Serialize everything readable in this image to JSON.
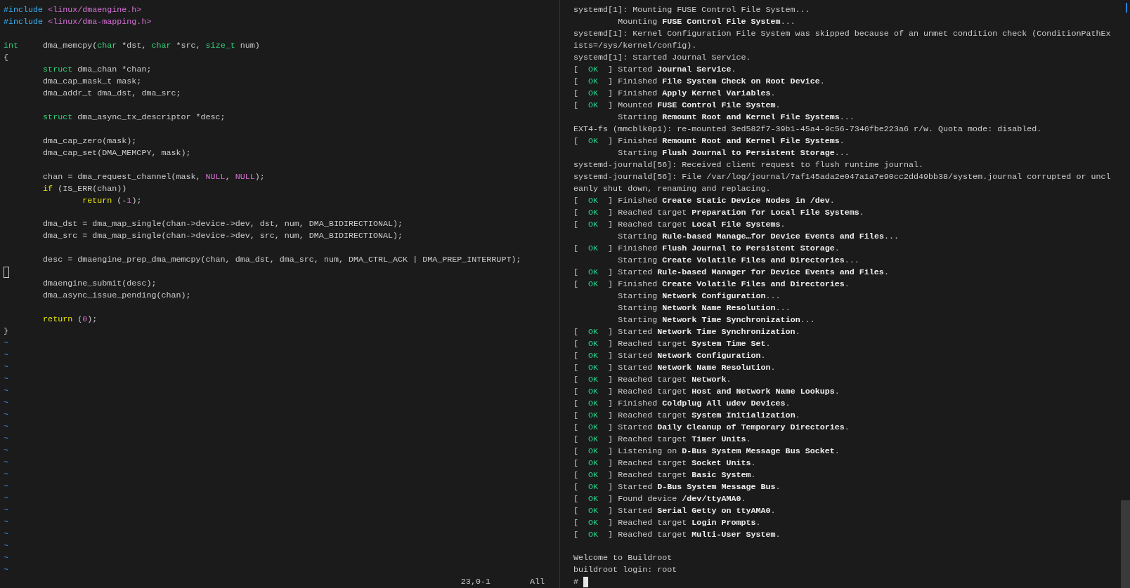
{
  "editor": {
    "lines": [
      {
        "kind": "code",
        "segments": [
          {
            "kind": "preproc",
            "text": "#include "
          },
          {
            "kind": "string",
            "text": "<linux/dmaengine.h>"
          }
        ]
      },
      {
        "kind": "code",
        "segments": [
          {
            "kind": "preproc",
            "text": "#include "
          },
          {
            "kind": "string",
            "text": "<linux/dma-mapping.h>"
          }
        ]
      },
      {
        "kind": "blank"
      },
      {
        "kind": "code",
        "segments": [
          {
            "kind": "type",
            "text": "int"
          },
          {
            "kind": "plain",
            "text": "\tdma_memcpy("
          },
          {
            "kind": "type",
            "text": "char"
          },
          {
            "kind": "plain",
            "text": " *dst, "
          },
          {
            "kind": "type",
            "text": "char"
          },
          {
            "kind": "plain",
            "text": " *src, "
          },
          {
            "kind": "type",
            "text": "size_t"
          },
          {
            "kind": "plain",
            "text": " num)"
          }
        ]
      },
      {
        "kind": "code",
        "segments": [
          {
            "kind": "plain",
            "text": "{"
          }
        ]
      },
      {
        "kind": "code",
        "segments": [
          {
            "kind": "type",
            "text": "\tstruct"
          },
          {
            "kind": "plain",
            "text": " dma_chan *chan;"
          }
        ]
      },
      {
        "kind": "code",
        "segments": [
          {
            "kind": "plain",
            "text": "\tdma_cap_mask_t mask;"
          }
        ]
      },
      {
        "kind": "code",
        "segments": [
          {
            "kind": "plain",
            "text": "\tdma_addr_t dma_dst, dma_src;"
          }
        ]
      },
      {
        "kind": "blank"
      },
      {
        "kind": "code",
        "segments": [
          {
            "kind": "type",
            "text": "\tstruct"
          },
          {
            "kind": "plain",
            "text": " dma_async_tx_descriptor *desc;"
          }
        ]
      },
      {
        "kind": "blank"
      },
      {
        "kind": "code",
        "segments": [
          {
            "kind": "plain",
            "text": "\tdma_cap_zero(mask);"
          }
        ]
      },
      {
        "kind": "code",
        "segments": [
          {
            "kind": "plain",
            "text": "\tdma_cap_set(DMA_MEMCPY, mask);"
          }
        ]
      },
      {
        "kind": "blank"
      },
      {
        "kind": "code",
        "segments": [
          {
            "kind": "plain",
            "text": "\tchan = dma_request_channel(mask, "
          },
          {
            "kind": "constant",
            "text": "NULL"
          },
          {
            "kind": "plain",
            "text": ", "
          },
          {
            "kind": "constant",
            "text": "NULL"
          },
          {
            "kind": "plain",
            "text": ");"
          }
        ]
      },
      {
        "kind": "code",
        "segments": [
          {
            "kind": "statement",
            "text": "\tif"
          },
          {
            "kind": "plain",
            "text": " (IS_ERR(chan))"
          }
        ]
      },
      {
        "kind": "code",
        "segments": [
          {
            "kind": "statement",
            "text": "\t\treturn"
          },
          {
            "kind": "plain",
            "text": " (-"
          },
          {
            "kind": "constant",
            "text": "1"
          },
          {
            "kind": "plain",
            "text": ");"
          }
        ]
      },
      {
        "kind": "blank"
      },
      {
        "kind": "code",
        "segments": [
          {
            "kind": "plain",
            "text": "\tdma_dst = dma_map_single(chan->device->dev, dst, num, DMA_BIDIRECTIONAL);"
          }
        ]
      },
      {
        "kind": "code",
        "segments": [
          {
            "kind": "plain",
            "text": "\tdma_src = dma_map_single(chan->device->dev, src, num, DMA_BIDIRECTIONAL);"
          }
        ]
      },
      {
        "kind": "blank"
      },
      {
        "kind": "code",
        "segments": [
          {
            "kind": "plain",
            "text": "\tdesc = dmaengine_prep_dma_memcpy(chan, dma_dst, dma_src, num, DMA_CTRL_ACK | DMA_PREP_INTERRUPT);"
          }
        ]
      },
      {
        "kind": "cursor"
      },
      {
        "kind": "code",
        "segments": [
          {
            "kind": "plain",
            "text": "\tdmaengine_submit(desc);"
          }
        ]
      },
      {
        "kind": "code",
        "segments": [
          {
            "kind": "plain",
            "text": "\tdma_async_issue_pending(chan);"
          }
        ]
      },
      {
        "kind": "blank"
      },
      {
        "kind": "code",
        "segments": [
          {
            "kind": "statement",
            "text": "\treturn"
          },
          {
            "kind": "plain",
            "text": " ("
          },
          {
            "kind": "constant",
            "text": "0"
          },
          {
            "kind": "plain",
            "text": ");"
          }
        ]
      },
      {
        "kind": "code",
        "segments": [
          {
            "kind": "plain",
            "text": "}"
          }
        ]
      }
    ],
    "filler_lines": [
      "~",
      "~",
      "~",
      "~",
      "~",
      "~",
      "~",
      "~",
      "~",
      "~",
      "~",
      "~",
      "~",
      "~",
      "~",
      "~",
      "~",
      "~",
      "~",
      "~"
    ],
    "status": {
      "position": "23,0-1",
      "scroll": "All"
    }
  },
  "terminal": {
    "lines": [
      {
        "kind": "log",
        "text": "systemd[1]: Mounting FUSE Control File System..."
      },
      {
        "kind": "job",
        "text": "Mounting **FUSE Control File System**..."
      },
      {
        "kind": "log",
        "text": "systemd[1]: Kernel Configuration File System was skipped because of an unmet condition check (ConditionPathEx"
      },
      {
        "kind": "log",
        "text": "ists=/sys/kernel/config)."
      },
      {
        "kind": "log",
        "text": "systemd[1]: Started Journal Service."
      },
      {
        "kind": "ok",
        "open": "[",
        "status": "OK",
        "close": "]",
        "text": "Started **Journal Service**."
      },
      {
        "kind": "ok",
        "open": "[",
        "status": "OK",
        "close": "]",
        "text": "Finished **File System Check on Root Device**."
      },
      {
        "kind": "ok",
        "open": "[",
        "status": "OK",
        "close": "]",
        "text": "Finished **Apply Kernel Variables**."
      },
      {
        "kind": "ok",
        "open": "[",
        "status": "OK",
        "close": "]",
        "text": "Mounted **FUSE Control File System**."
      },
      {
        "kind": "job",
        "text": "Starting **Remount Root and Kernel File Systems**..."
      },
      {
        "kind": "log",
        "text": "EXT4-fs (mmcblk0p1): re-mounted 3ed582f7-39b1-45a4-9c56-7346fbe223a6 r/w. Quota mode: disabled."
      },
      {
        "kind": "ok",
        "open": "[",
        "status": "OK",
        "close": "]",
        "text": "Finished **Remount Root and Kernel File Systems**."
      },
      {
        "kind": "job",
        "text": "Starting **Flush Journal to Persistent Storage**..."
      },
      {
        "kind": "log",
        "text": "systemd-journald[56]: Received client request to flush runtime journal."
      },
      {
        "kind": "log",
        "text": "systemd-journald[56]: File /var/log/journal/7af145ada2e047a1a7e90cc2dd49bb38/system.journal corrupted or uncl"
      },
      {
        "kind": "log",
        "text": "eanly shut down, renaming and replacing."
      },
      {
        "kind": "ok",
        "open": "[",
        "status": "OK",
        "close": "]",
        "text": "Finished **Create Static Device Nodes in /dev**."
      },
      {
        "kind": "ok",
        "open": "[",
        "status": "OK",
        "close": "]",
        "text": "Reached target **Preparation for Local File Systems**."
      },
      {
        "kind": "ok",
        "open": "[",
        "status": "OK",
        "close": "]",
        "text": "Reached target **Local File Systems**."
      },
      {
        "kind": "job",
        "text": "Starting **Rule-based Manage…for Device Events and Files**..."
      },
      {
        "kind": "ok",
        "open": "[",
        "status": "OK",
        "close": "]",
        "text": "Finished **Flush Journal to Persistent Storage**."
      },
      {
        "kind": "job",
        "text": "Starting **Create Volatile Files and Directories**..."
      },
      {
        "kind": "ok",
        "open": "[",
        "status": "OK",
        "close": "]",
        "text": "Started **Rule-based Manager for Device Events and Files**."
      },
      {
        "kind": "ok",
        "open": "[",
        "status": "OK",
        "close": "]",
        "text": "Finished **Create Volatile Files and Directories**."
      },
      {
        "kind": "job",
        "text": "Starting **Network Configuration**..."
      },
      {
        "kind": "job",
        "text": "Starting **Network Name Resolution**..."
      },
      {
        "kind": "job",
        "text": "Starting **Network Time Synchronization**..."
      },
      {
        "kind": "ok",
        "open": "[",
        "status": "OK",
        "close": "]",
        "text": "Started **Network Time Synchronization**."
      },
      {
        "kind": "ok",
        "open": "[",
        "status": "OK",
        "close": "]",
        "text": "Reached target **System Time Set**."
      },
      {
        "kind": "ok",
        "open": "[",
        "status": "OK",
        "close": "]",
        "text": "Started **Network Configuration**."
      },
      {
        "kind": "ok",
        "open": "[",
        "status": "OK",
        "close": "]",
        "text": "Started **Network Name Resolution**."
      },
      {
        "kind": "ok",
        "open": "[",
        "status": "OK",
        "close": "]",
        "text": "Reached target **Network**."
      },
      {
        "kind": "ok",
        "open": "[",
        "status": "OK",
        "close": "]",
        "text": "Reached target **Host and Network Name Lookups**."
      },
      {
        "kind": "ok",
        "open": "[",
        "status": "OK",
        "close": "]",
        "text": "Finished **Coldplug All udev Devices**."
      },
      {
        "kind": "ok",
        "open": "[",
        "status": "OK",
        "close": "]",
        "text": "Reached target **System Initialization**."
      },
      {
        "kind": "ok",
        "open": "[",
        "status": "OK",
        "close": "]",
        "text": "Started **Daily Cleanup of Temporary Directories**."
      },
      {
        "kind": "ok",
        "open": "[",
        "status": "OK",
        "close": "]",
        "text": "Reached target **Timer Units**."
      },
      {
        "kind": "ok",
        "open": "[",
        "status": "OK",
        "close": "]",
        "text": "Listening on **D-Bus System Message Bus Socket**."
      },
      {
        "kind": "ok",
        "open": "[",
        "status": "OK",
        "close": "]",
        "text": "Reached target **Socket Units**."
      },
      {
        "kind": "ok",
        "open": "[",
        "status": "OK",
        "close": "]",
        "text": "Reached target **Basic System**."
      },
      {
        "kind": "ok",
        "open": "[",
        "status": "OK",
        "close": "]",
        "text": "Started **D-Bus System Message Bus**."
      },
      {
        "kind": "ok",
        "open": "[",
        "status": "OK",
        "close": "]",
        "text": "Found device **/dev/ttyAMA0**."
      },
      {
        "kind": "ok",
        "open": "[",
        "status": "OK",
        "close": "]",
        "text": "Started **Serial Getty on ttyAMA0**."
      },
      {
        "kind": "ok",
        "open": "[",
        "status": "OK",
        "close": "]",
        "text": "Reached target **Login Prompts**."
      },
      {
        "kind": "ok",
        "open": "[",
        "status": "OK",
        "close": "]",
        "text": "Reached target **Multi-User System**."
      },
      {
        "kind": "blank"
      },
      {
        "kind": "log",
        "text": "Welcome to Buildroot"
      },
      {
        "kind": "log",
        "text": "buildroot login: root"
      },
      {
        "kind": "prompt",
        "text": "#"
      }
    ]
  }
}
